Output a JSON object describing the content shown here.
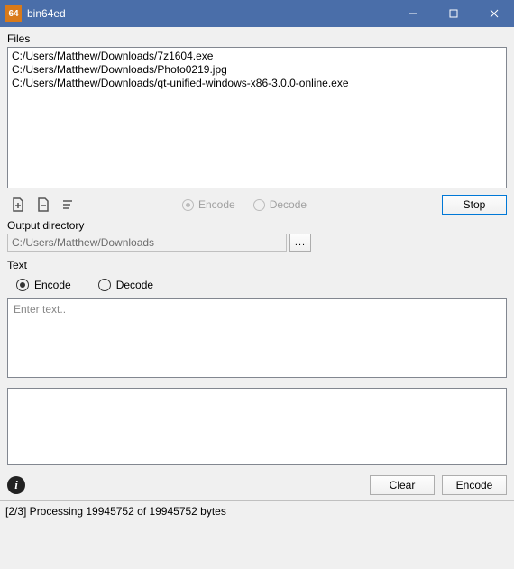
{
  "window": {
    "title": "bin64ed",
    "icon_text": "64"
  },
  "files": {
    "label": "Files",
    "items": [
      "C:/Users/Matthew/Downloads/7z1604.exe",
      "C:/Users/Matthew/Downloads/Photo0219.jpg",
      "C:/Users/Matthew/Downloads/qt-unified-windows-x86-3.0.0-online.exe"
    ]
  },
  "file_mode": {
    "encode_label": "Encode",
    "decode_label": "Decode",
    "selected": "encode"
  },
  "stop_button": "Stop",
  "output_dir": {
    "label": "Output directory",
    "value": "C:/Users/Matthew/Downloads",
    "browse": "..."
  },
  "text_section": {
    "label": "Text",
    "encode_label": "Encode",
    "decode_label": "Decode",
    "selected": "encode",
    "input_placeholder": "Enter text..",
    "input_value": "",
    "output_value": ""
  },
  "buttons": {
    "clear": "Clear",
    "encode": "Encode"
  },
  "status": "[2/3] Processing 19945752 of 19945752 bytes"
}
